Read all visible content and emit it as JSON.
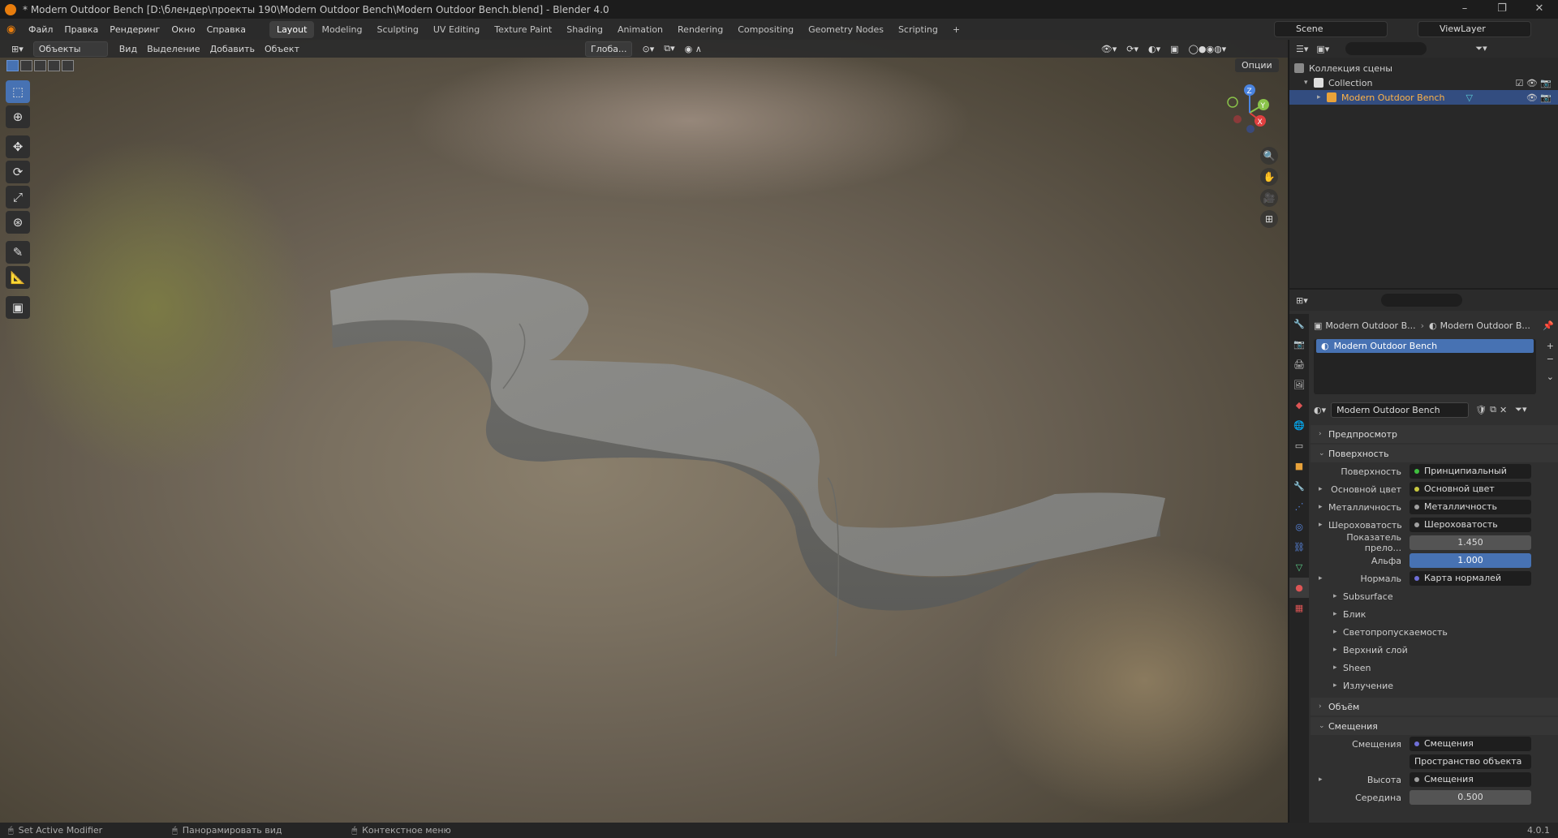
{
  "window": {
    "title": "* Modern Outdoor Bench [D:\\блендер\\проекты 190\\Modern Outdoor Bench\\Modern Outdoor Bench.blend] - Blender 4.0",
    "minimize": "–",
    "maximize": "❐",
    "close": "✕"
  },
  "menu": [
    "Файл",
    "Правка",
    "Рендеринг",
    "Окно",
    "Справка"
  ],
  "workspaces": [
    "Layout",
    "Modeling",
    "Sculpting",
    "UV Editing",
    "Texture Paint",
    "Shading",
    "Animation",
    "Rendering",
    "Compositing",
    "Geometry Nodes",
    "Scripting",
    "+"
  ],
  "active_workspace": "Layout",
  "scene": {
    "label": "Scene",
    "view_layer": "ViewLayer"
  },
  "viewport": {
    "mode": "Объекты",
    "menus": [
      "Вид",
      "Выделение",
      "Добавить",
      "Объект"
    ],
    "orientation": "Глоба...",
    "options": "Опции"
  },
  "outliner": {
    "root": "Коллекция сцены",
    "collection": "Collection",
    "object": "Modern Outdoor Bench"
  },
  "properties": {
    "breadcrumb1": "Modern Outdoor B...",
    "breadcrumb2": "Modern Outdoor B...",
    "slot": "Modern Outdoor Bench",
    "material": "Modern Outdoor Bench",
    "sections": {
      "preview": "Предпросмотр",
      "surface": "Поверхность",
      "volume": "Объём",
      "displacement": "Смещения"
    },
    "rows": [
      {
        "label": "Поверхность",
        "value": "Принципиальный BSDF",
        "dot": "#3fbf3f"
      },
      {
        "label": "Основной цвет",
        "value": "Основной цвет",
        "dot": "#c8c83f",
        "expand": true
      },
      {
        "label": "Металличность",
        "value": "Металличность",
        "dot": "#a0a0a0",
        "expand": true
      },
      {
        "label": "Шероховатость",
        "value": "Шероховатость",
        "dot": "#a0a0a0",
        "expand": true
      },
      {
        "label": "Показатель прело...",
        "value": "1.450",
        "num": true
      },
      {
        "label": "Альфа",
        "value": "1.000",
        "blue": true
      },
      {
        "label": "Нормаль",
        "value": "Карта нормалей",
        "dot": "#6f6fd8",
        "expand": true
      }
    ],
    "subpanels": [
      "Subsurface",
      "Блик",
      "Светопропускаемость",
      "Верхний слой",
      "Sheen",
      "Излучение"
    ],
    "disp_rows": [
      {
        "label": "Смещения",
        "value": "Смещения",
        "dot": "#6f6fd8"
      },
      {
        "label": "",
        "value": "Пространство объекта",
        "dropdown": true
      },
      {
        "label": "Высота",
        "value": "Смещения",
        "dot": "#a0a0a0",
        "expand": true
      },
      {
        "label": "Середина",
        "value": "0.500",
        "num": true
      }
    ]
  },
  "statusbar": {
    "left": "Set Active Modifier",
    "mid": "Панорамировать вид",
    "right": "Контекстное меню",
    "version": "4.0.1"
  },
  "gizmo": {
    "x": "X",
    "y": "Y",
    "z": "Z"
  }
}
